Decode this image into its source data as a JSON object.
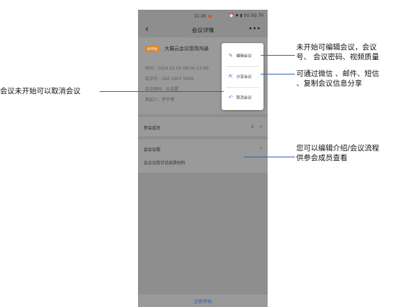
{
  "status": {
    "time": "11:26",
    "right": "⏰ ✱ ▮ 5G 5G 70"
  },
  "appbar": {
    "title": "会议详情"
  },
  "meeting": {
    "tag": "未开始",
    "title": "大展云会议现场沟通",
    "time": "时间：2024.02.02 09:00-13:00",
    "number": "会议号：292 1607 5656",
    "password": "会议密码：未设置",
    "host": "发起人：李宇博"
  },
  "menu": {
    "items": [
      {
        "label": "编辑会议",
        "icon": "edit-icon"
      },
      {
        "label": "分享会议",
        "icon": "share-icon"
      },
      {
        "label": "取消会议",
        "icon": "undo-icon"
      }
    ]
  },
  "participants": {
    "label": "参会成员",
    "count": "3"
  },
  "agenda": {
    "label": "会议议程",
    "content": "会议议程详见纸质材料"
  },
  "footer": {
    "start_label": "立即开始"
  },
  "annotations": {
    "cancel": "会议未开始可以取消会议",
    "edit_line1": "未开始可编辑会议，会议",
    "edit_line2": "号、 会议密码、视频质量",
    "share_line1": "可通过微信 、邮件、短信",
    "share_line2": "、复制会议信息分享",
    "agenda_line1": "您可以编辑介绍/会议流程",
    "agenda_line2": "供参会成员查看"
  }
}
